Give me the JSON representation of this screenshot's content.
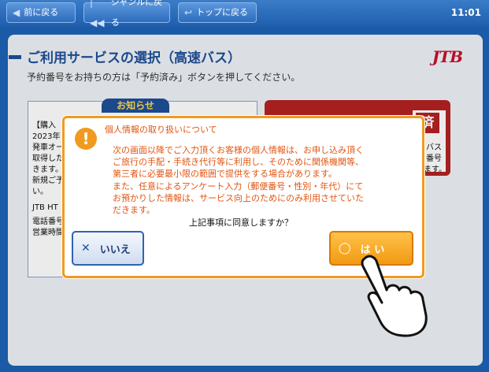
{
  "header": {
    "back_label": "前に戻る",
    "genre_back_label": "ジャンルに戻る",
    "top_back_label": "トップに戻る",
    "clock": "11:01"
  },
  "main": {
    "title": "ご利用サービスの選択（高速バス）",
    "subtitle": "予約番号をお持ちの方は「予約済み」ボタンを押してください。",
    "logo": "JTB"
  },
  "notice": {
    "tab": "お知らせ",
    "lines": [
      "【購入",
      "2023年",
      "発車オー",
      "取得した",
      "きます。",
      "新規ご予",
      "い。",
      "",
      "JTB HT",
      "電話番号",
      "営業時間"
    ]
  },
  "reserved": {
    "badge": "済",
    "lines": [
      "バス",
      "番号",
      "ます。"
    ]
  },
  "dialog": {
    "title": "個人情報の取り扱いについて",
    "body": [
      "次の画面以降でご入力頂くお客様の個人情報は、お申し込み頂く",
      "ご旅行の手配・手続き代行等に利用し、そのために関係機関等、",
      "第三者に必要最小限の範囲で提供をする場合があります。",
      "また、任意によるアンケート入力（郵便番号・性別・年代）にて",
      "お預かりした情報は、サービス向上のためにのみ利用させていた",
      "だきます。"
    ],
    "question": "上記事項に同意しますか？",
    "no_label": "いいえ",
    "yes_label": "は い"
  },
  "colors": {
    "accent_blue": "#1f4f98",
    "dialog_orange": "#f09a1f",
    "text_orange": "#e2540f",
    "brand_red": "#c8102e"
  }
}
